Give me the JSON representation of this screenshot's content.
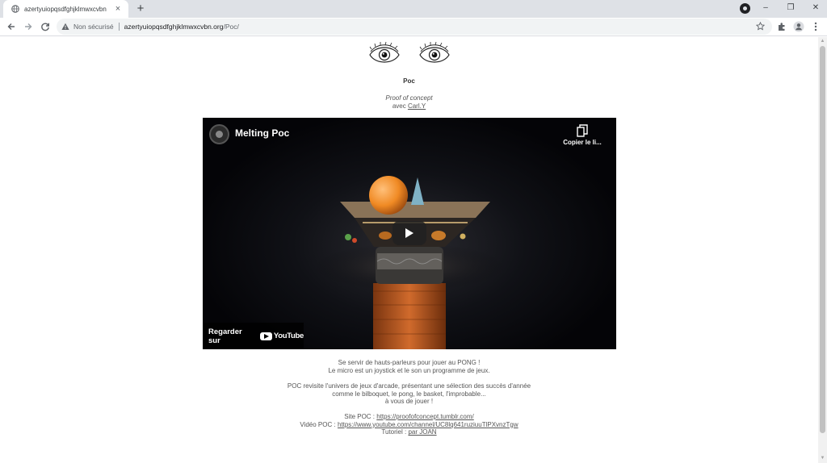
{
  "browser": {
    "tab_title": "azertyuiopqsdfghjklmwxcvbn",
    "tab_close": "×",
    "new_tab": "+",
    "window_min": "–",
    "window_restore": "❐",
    "window_close": "✕",
    "security_label": "Non sécurisé",
    "url_host": "azertyuiopqsdfghjklmwxcvbn.org",
    "url_path": "/Poc/"
  },
  "page": {
    "title": "Poc",
    "subtitle": "Proof of concept",
    "avec_prefix": "avec ",
    "avec_link": "Carl.Y"
  },
  "video": {
    "title": "Melting Poc",
    "copy_label": "Copier le li...",
    "watch_label": "Regarder sur",
    "youtube_text": "YouTube"
  },
  "description": {
    "line1": "Se servir de hauts-parleurs pour jouer au PONG !",
    "line2": "Le micro est un joystick et le son un programme de jeux.",
    "line3": "POC revisite l'univers de jeux d'arcade, présentant une sélection des succès d'année",
    "line4": "comme le bilboquet, le pong, le basket, l'improbable...",
    "line5": "à vous de jouer !",
    "site_prefix": "Site POC : ",
    "site_link": "https://proofofconcept.tumblr.com/",
    "video_prefix": "Vidéo POC : ",
    "video_link": "https://www.youtube.com/channel/UC8lq641ruziuuTlPXvnzTgw",
    "tuto_prefix": "Tutoriel : ",
    "tuto_link": "par JOAN"
  }
}
